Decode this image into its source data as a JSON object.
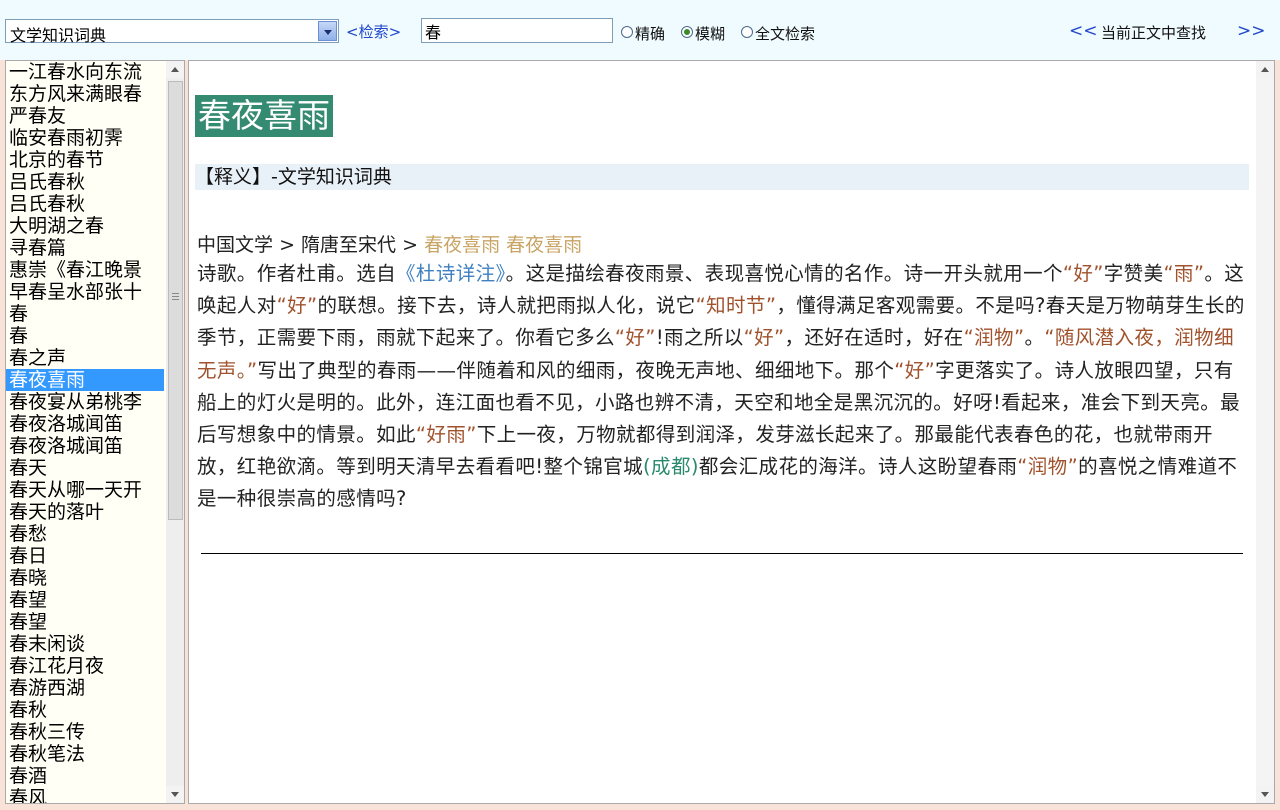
{
  "toolbar": {
    "dictionary_select": "文学知识词典",
    "search_button": "<检索>",
    "search_value": "春",
    "modes": [
      {
        "label": "精确",
        "checked": false
      },
      {
        "label": "模糊",
        "checked": true
      },
      {
        "label": "全文检索",
        "checked": false
      }
    ],
    "prev": "<<",
    "find_label": "当前正文中查找",
    "next": ">>"
  },
  "sidebar": {
    "selected_index": 14,
    "items": [
      "一江春水向东流",
      "东方风来满眼春",
      "严春友",
      "临安春雨初霁",
      "北京的春节",
      "吕氏春秋",
      "吕氏春秋",
      "大明湖之春",
      "寻春篇",
      "惠崇《春江晚景",
      "早春呈水部张十",
      "春",
      "春",
      "春之声",
      "春夜喜雨",
      "春夜宴从弟桃李",
      "春夜洛城闻笛",
      "春夜洛城闻笛",
      "春天",
      "春天从哪一天开",
      "春天的落叶",
      "春愁",
      "春日",
      "春晓",
      "春望",
      "春望",
      "春末闲谈",
      "春江花月夜",
      "春游西湖",
      "春秋",
      "春秋三传",
      "春秋笔法",
      "春酒",
      "春风"
    ]
  },
  "entry": {
    "title": "春夜喜雨",
    "meaning_header": "【释义】-文学知识词典",
    "breadcrumb": {
      "root": "中国文学",
      "sep": ">",
      "period": "隋唐至宋代",
      "link1": "春夜喜雨",
      "link2": "春夜喜雨"
    },
    "body": [
      {
        "t": "诗歌。作者杜甫。选自"
      },
      {
        "t": "《杜诗详注》",
        "s": "bk"
      },
      {
        "t": "。这是描绘春夜雨景、表现喜悦心情的名作。诗一开头就用一个"
      },
      {
        "t": "“好”",
        "s": "q"
      },
      {
        "t": "字赞美"
      },
      {
        "t": "“雨”",
        "s": "q"
      },
      {
        "t": "。这唤起人对"
      },
      {
        "t": "“好”",
        "s": "q"
      },
      {
        "t": "的联想。接下去，诗人就把雨拟人化，说它"
      },
      {
        "t": "“知时节”",
        "s": "q"
      },
      {
        "t": "，懂得满足客观需要。不是吗?春天是万物萌芽生长的季节，正需要下雨，雨就下起来了。你看它多么"
      },
      {
        "t": "“好”",
        "s": "q"
      },
      {
        "t": "!雨之所以"
      },
      {
        "t": "“好”",
        "s": "q"
      },
      {
        "t": "，还好在适时，好在"
      },
      {
        "t": "“润物”",
        "s": "q"
      },
      {
        "t": "。"
      },
      {
        "t": "“随风潜入夜，润物细无声。”",
        "s": "q"
      },
      {
        "t": "写出了典型的春雨——伴随着和风的细雨，夜晚无声地、细细地下。那个"
      },
      {
        "t": "“好”",
        "s": "q"
      },
      {
        "t": "字更落实了。诗人放眼四望，只有船上的灯火是明的。此外，连江面也看不见，小路也辨不清，天空和地全是黑沉沉的。好呀!看起来，准会下到天亮。最后写想象中的情景。如此"
      },
      {
        "t": "“好雨”",
        "s": "q"
      },
      {
        "t": "下上一夜，万物就都得到润泽，发芽滋长起来了。那最能代表春色的花，也就带雨开放，红艳欲滴。等到明天清早去看看吧!整个锦官城"
      },
      {
        "t": "(成都)",
        "s": "pl"
      },
      {
        "t": "都会汇成花的海洋。诗人这盼望春雨"
      },
      {
        "t": "“润物”",
        "s": "q"
      },
      {
        "t": "的喜悦之情难道不是一种很崇高的感情吗?"
      }
    ]
  }
}
